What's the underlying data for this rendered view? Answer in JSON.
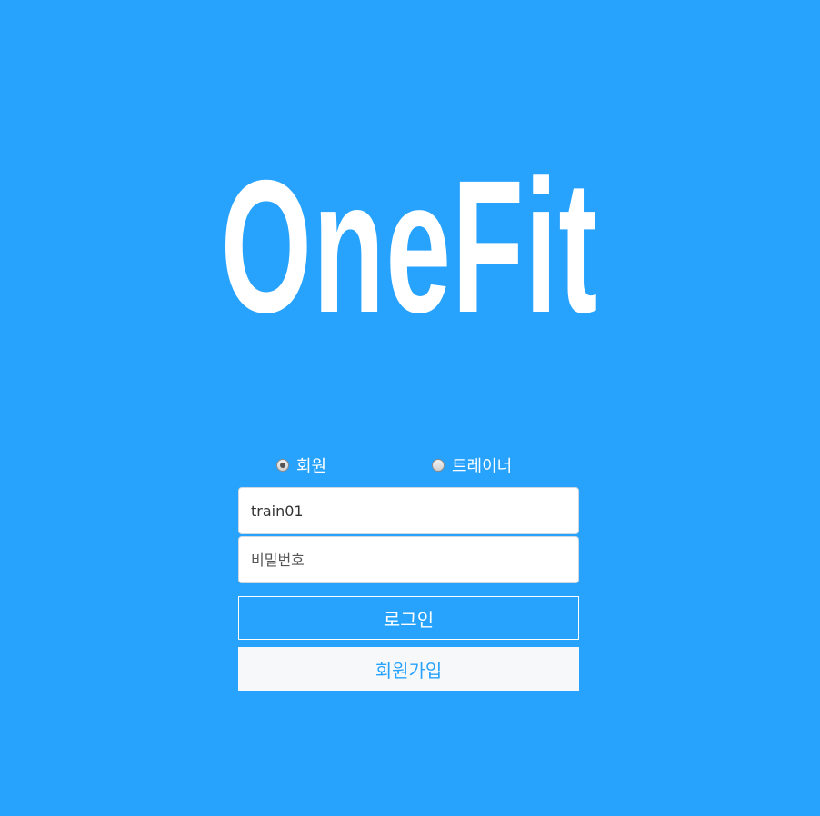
{
  "brand": {
    "logo_text": "OneFit"
  },
  "roles": {
    "member_label": "회원",
    "trainer_label": "트레이너",
    "selected": "member"
  },
  "form": {
    "id_value": "train01",
    "password_placeholder": "비밀번호"
  },
  "buttons": {
    "login_label": "로그인",
    "signup_label": "회원가입"
  },
  "colors": {
    "background": "#27a3fe",
    "text": "#ffffff",
    "signup_bg": "#f7f8fa",
    "signup_text": "#27a3fe"
  }
}
